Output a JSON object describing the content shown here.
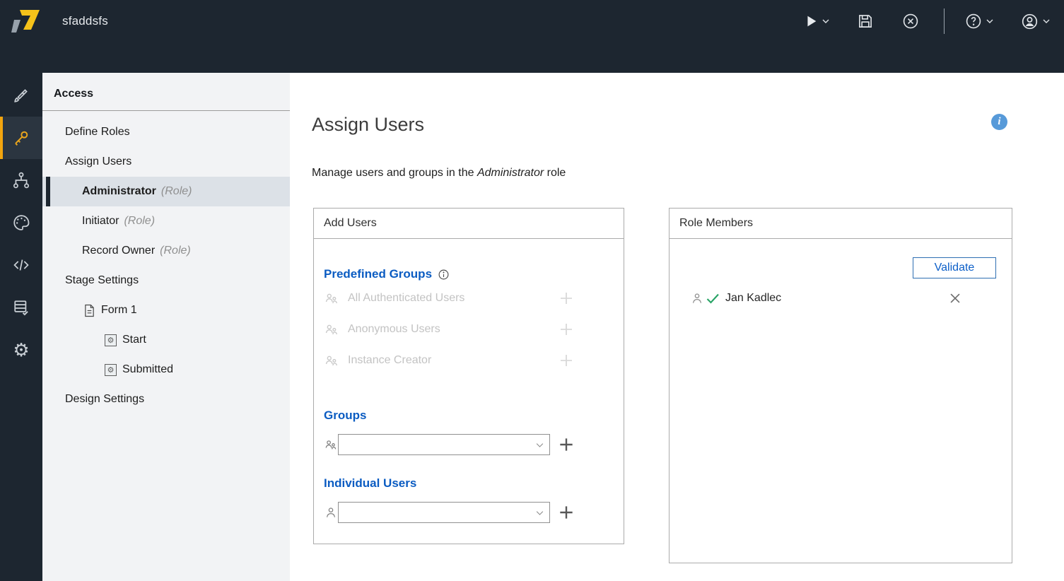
{
  "header": {
    "title": "sfaddsfs",
    "toolbar_icons": [
      "play-icon",
      "save-icon",
      "close-icon",
      "help-icon",
      "account-icon"
    ]
  },
  "rail": {
    "items": [
      {
        "icon": "brush-icon",
        "active": false
      },
      {
        "icon": "key-icon",
        "active": true
      },
      {
        "icon": "org-chart-icon",
        "active": false
      },
      {
        "icon": "palette-icon",
        "active": false
      },
      {
        "icon": "code-icon",
        "active": false
      },
      {
        "icon": "forms-list-icon",
        "active": false
      },
      {
        "icon": "settings-gear-icon",
        "active": false
      }
    ],
    "gear_glyph": "⚙"
  },
  "nav": {
    "heading": "Access",
    "items": [
      {
        "label": "Define Roles"
      },
      {
        "label": "Assign Users"
      },
      {
        "label": "Administrator",
        "suffix": "(Role)",
        "selected": true
      },
      {
        "label": "Initiator",
        "suffix": "(Role)"
      },
      {
        "label": "Record Owner",
        "suffix": "(Role)"
      },
      {
        "label": "Stage Settings"
      },
      {
        "label": "Form 1",
        "icon": "form-page-icon"
      },
      {
        "label": "Start",
        "icon": "stage-gear-icon"
      },
      {
        "label": "Submitted",
        "icon": "stage-gear-icon"
      },
      {
        "label": "Design Settings"
      }
    ],
    "stage_gear_glyph": "⚙"
  },
  "main": {
    "page_title": "Assign Users",
    "info_glyph": "i",
    "description": {
      "prefix": "Manage users and groups in the ",
      "role": "Administrator",
      "suffix": " role"
    },
    "add_users": {
      "title": "Add Users",
      "predefined_heading": "Predefined Groups",
      "predefined_items": [
        {
          "label": "All Authenticated Users",
          "icon": "group-icon",
          "disabled": true
        },
        {
          "label": "Anonymous Users",
          "icon": "group-icon",
          "disabled": true
        },
        {
          "label": "Instance Creator",
          "icon": "group-icon",
          "disabled": true
        }
      ],
      "groups_heading": "Groups",
      "individual_heading": "Individual Users"
    },
    "role_members": {
      "title": "Role Members",
      "validate_label": "Validate",
      "members": [
        {
          "name": "Jan Kadlec",
          "status_icon": "check-icon"
        }
      ]
    }
  },
  "colors": {
    "header_bg": "#1d2630",
    "accent_blue": "#0b5cc2",
    "active_amber": "#eda41c",
    "active_bar": "#f1a40e",
    "selected_nav_bg": "#dce1e7",
    "success_green": "#27a365",
    "info_blue": "#579ad9",
    "disabled_text": "#c3c3c3",
    "panel_border": "#ababab"
  }
}
